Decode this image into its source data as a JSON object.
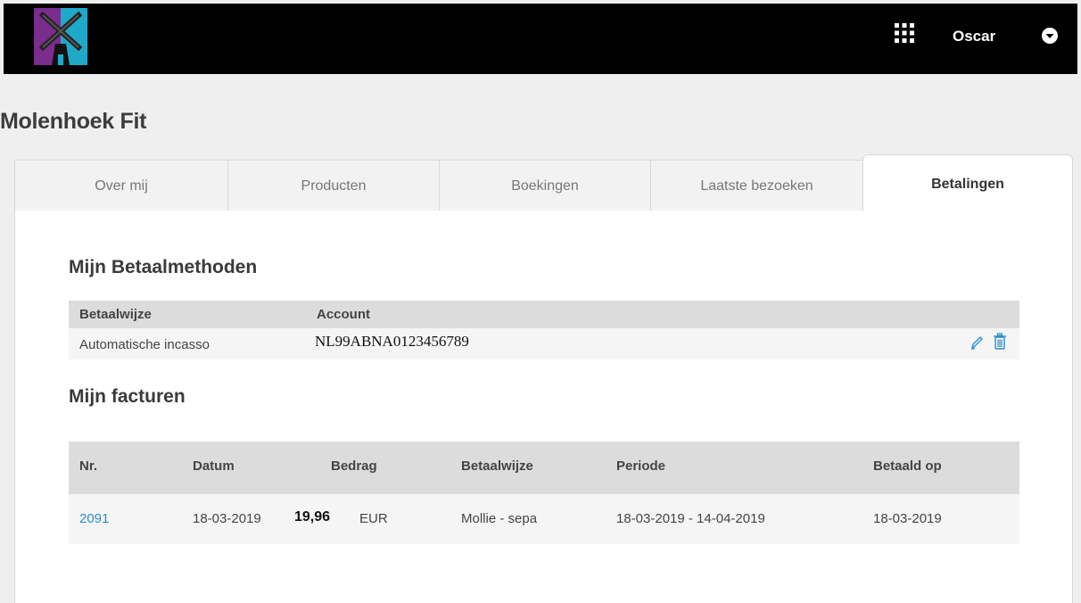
{
  "header": {
    "username": "Oscar"
  },
  "page_title": "Molenhoek Fit",
  "tabs": [
    {
      "label": "Over mij"
    },
    {
      "label": "Producten"
    },
    {
      "label": "Boekingen"
    },
    {
      "label": "Laatste bezoeken"
    },
    {
      "label": "Betalingen",
      "active": true
    }
  ],
  "payment_methods": {
    "title": "Mijn Betaalmethoden",
    "columns": [
      "Betaalwijze",
      "Account"
    ],
    "rows": [
      {
        "method": "Automatische incasso",
        "account": "NL99ABNA0123456789"
      }
    ]
  },
  "invoices": {
    "title": "Mijn facturen",
    "columns": [
      "Nr.",
      "Datum",
      "Bedrag",
      "Betaalwijze",
      "Periode",
      "Betaald op"
    ],
    "rows": [
      {
        "nr": "2091",
        "datum": "18-03-2019",
        "bedrag": "19,96",
        "currency": "EUR",
        "betaalwijze": "Mollie - sepa",
        "periode": "18-03-2019 - 14-04-2019",
        "betaald_op": "18-03-2019"
      }
    ]
  },
  "colors": {
    "accent_link": "#2a8fd0",
    "logo_left": "#7b2d8e",
    "logo_right": "#1fa9c9"
  }
}
